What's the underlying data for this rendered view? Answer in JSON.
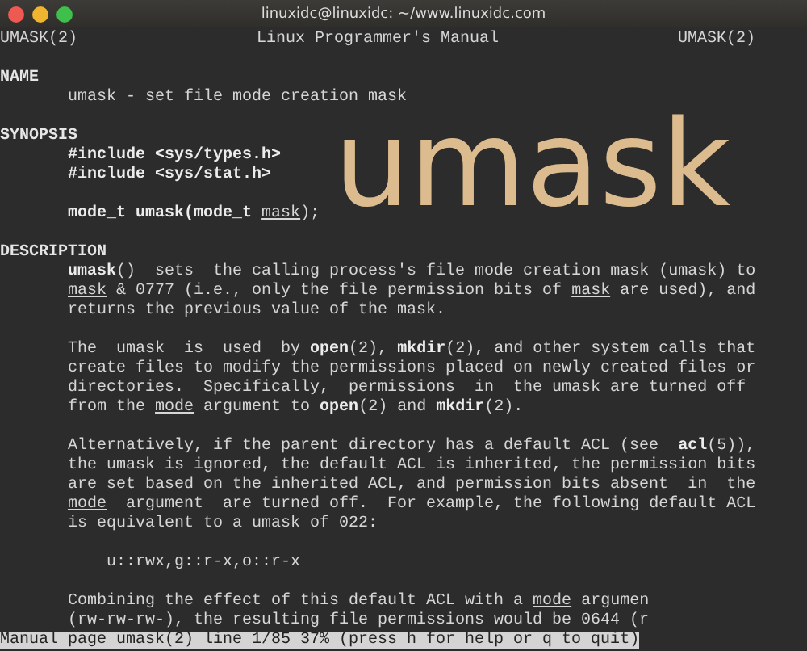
{
  "window": {
    "title": "linuxidc@linuxidc: ~/www.linuxidc.com"
  },
  "header": {
    "left": "UMASK(2)",
    "center": "Linux Programmer's Manual",
    "right": "UMASK(2)"
  },
  "overlay_title": "umask",
  "sections": [
    {
      "heading": "NAME",
      "paragraphs": [
        {
          "kind": "text",
          "lines": [
            "umask - set file mode creation mask"
          ]
        }
      ]
    },
    {
      "heading": "SYNOPSIS",
      "paragraphs": [
        {
          "kind": "text",
          "lines": [
            "**#include <sys/types.h>**",
            "**#include <sys/stat.h>**"
          ]
        },
        {
          "kind": "text",
          "lines": [
            "**mode_t umask(mode_t** *mask*);"
          ]
        }
      ]
    },
    {
      "heading": "DESCRIPTION",
      "paragraphs": [
        {
          "kind": "text",
          "lines": [
            "**umask**()  sets  the calling process's file mode creation mask (umask) to",
            "*mask* & 0777 (i.e., only the file permission bits of *mask* are used), and",
            "returns the previous value of the mask."
          ]
        },
        {
          "kind": "text",
          "lines": [
            "The  umask  is  used  by **open**(2), **mkdir**(2), and other system calls that",
            "create files to modify the permissions placed on newly created files or",
            "directories.  Specifically,  permissions  in  the umask are turned off",
            "from the *mode* argument to **open**(2) and **mkdir**(2)."
          ]
        },
        {
          "kind": "text",
          "lines": [
            "Alternatively, if the parent directory has a default ACL (see  **acl**(5)),",
            "the umask is ignored, the default ACL is inherited, the permission bits",
            "are set based on the inherited ACL, and permission bits absent  in  the",
            "*mode*  argument  are turned off.  For example, the following default ACL",
            "is equivalent to a umask of 022:"
          ]
        },
        {
          "kind": "code",
          "lines": [
            "u::rwx,g::r-x,o::r-x"
          ]
        },
        {
          "kind": "text",
          "lines": [
            "Combining the effect of this default ACL with a *mode* argumen",
            "(rw-rw-rw-), the resulting file permissions would be 0644 (r"
          ]
        }
      ]
    }
  ],
  "status_bar": "Manual page umask(2) line 1/85 37% (press h for help or q to quit)"
}
